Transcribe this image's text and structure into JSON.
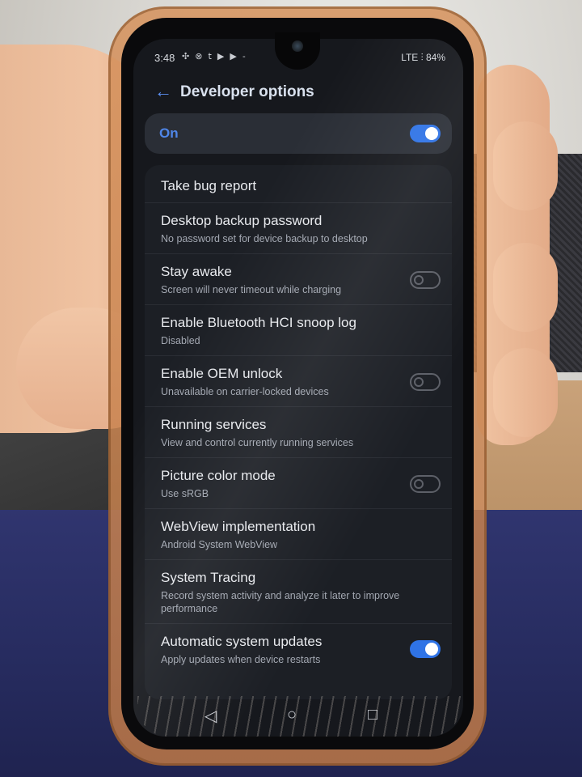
{
  "status_bar": {
    "time": "3:48",
    "left_icons": "✣ ⊗ 𝗍 ▶ ▶ -",
    "right_text": "LTE ⫶ 84%",
    "battery": "84%"
  },
  "header": {
    "back_icon": "arrow-left-icon",
    "title": "Developer options"
  },
  "master_toggle": {
    "label": "On",
    "state": "on",
    "accent": "#2f73e6"
  },
  "settings": [
    {
      "title": "Take bug report",
      "subtitle": "",
      "toggle": null
    },
    {
      "title": "Desktop backup password",
      "subtitle": "No password set for device backup to desktop",
      "toggle": null
    },
    {
      "title": "Stay awake",
      "subtitle": "Screen will never timeout while charging",
      "toggle": "off"
    },
    {
      "title": "Enable Bluetooth HCI snoop log",
      "subtitle": "Disabled",
      "toggle": null
    },
    {
      "title": "Enable OEM unlock",
      "subtitle": "Unavailable on carrier-locked devices",
      "toggle": "off"
    },
    {
      "title": "Running services",
      "subtitle": "View and control currently running services",
      "toggle": null
    },
    {
      "title": "Picture color mode",
      "subtitle": "Use sRGB",
      "toggle": "off"
    },
    {
      "title": "WebView implementation",
      "subtitle": "Android System WebView",
      "toggle": null
    },
    {
      "title": "System Tracing",
      "subtitle": "Record system activity and analyze it later to improve performance",
      "toggle": null
    },
    {
      "title": "Automatic system updates",
      "subtitle": "Apply updates when device restarts",
      "toggle": "on"
    }
  ],
  "nav_bar": {
    "back": "◁",
    "home": "○",
    "recents": "□"
  }
}
